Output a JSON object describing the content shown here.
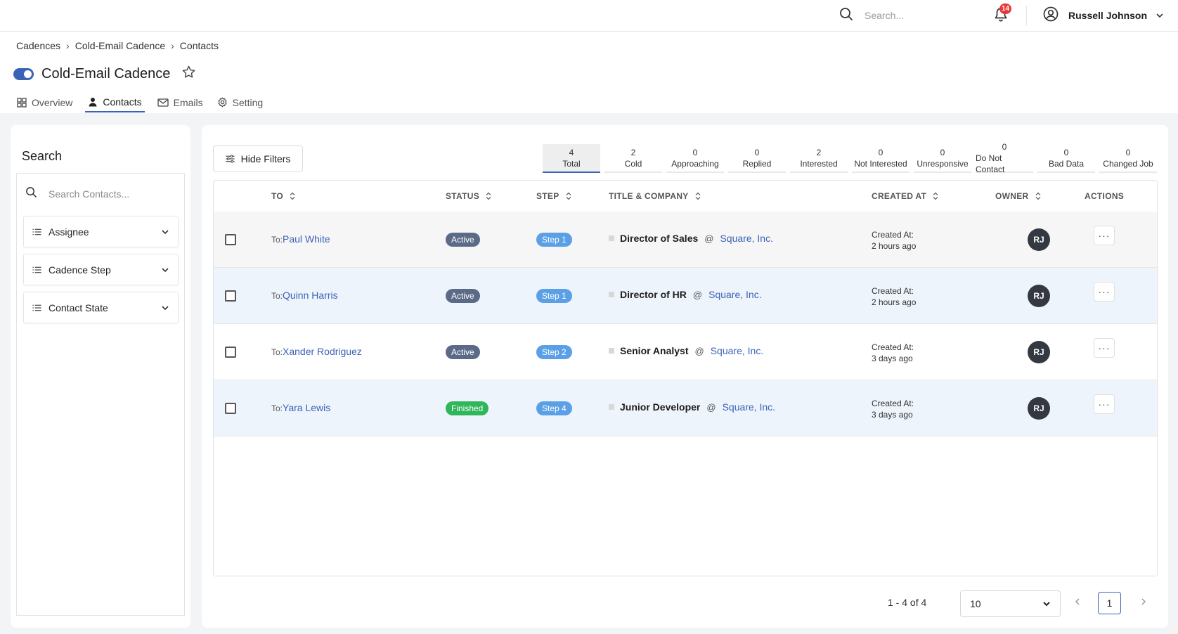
{
  "topbar": {
    "search_placeholder": "Search...",
    "notification_count": "14",
    "user_name": "Russell Johnson"
  },
  "breadcrumb": [
    "Cadences",
    "Cold-Email Cadence",
    "Contacts"
  ],
  "page": {
    "title": "Cold-Email Cadence",
    "tabs": [
      {
        "label": "Overview",
        "icon": "grid-icon"
      },
      {
        "label": "Contacts",
        "icon": "person-icon"
      },
      {
        "label": "Emails",
        "icon": "mail-icon"
      },
      {
        "label": "Setting",
        "icon": "gear-icon"
      }
    ],
    "active_tab": "Contacts"
  },
  "filters": {
    "heading": "Search",
    "search_placeholder": "Search Contacts...",
    "groups": [
      "Assignee",
      "Cadence Step",
      "Contact State"
    ]
  },
  "toolbar": {
    "hide_filters_label": "Hide Filters"
  },
  "stats": [
    {
      "count": "4",
      "label": "Total"
    },
    {
      "count": "2",
      "label": "Cold"
    },
    {
      "count": "0",
      "label": "Approaching"
    },
    {
      "count": "0",
      "label": "Replied"
    },
    {
      "count": "2",
      "label": "Interested"
    },
    {
      "count": "0",
      "label": "Not Interested"
    },
    {
      "count": "0",
      "label": "Unresponsive"
    },
    {
      "count": "0",
      "label": "Do Not Contact"
    },
    {
      "count": "0",
      "label": "Bad Data"
    },
    {
      "count": "0",
      "label": "Changed Job"
    }
  ],
  "table": {
    "headers": {
      "to": "TO",
      "status": "STATUS",
      "step": "STEP",
      "title_company": "TITLE & COMPANY",
      "created_at": "CREATED AT",
      "owner": "OWNER",
      "actions": "ACTIONS"
    },
    "to_prefix": "To:",
    "at_symbol": "@",
    "created_prefix": "Created At:",
    "rows": [
      {
        "name": "Paul White",
        "status": "Active",
        "step": "Step 1",
        "title": "Director of Sales",
        "company": "Square, Inc.",
        "created": "2 hours ago",
        "owner": "RJ"
      },
      {
        "name": "Quinn Harris",
        "status": "Active",
        "step": "Step 1",
        "title": "Director of HR",
        "company": "Square, Inc.",
        "created": "2 hours ago",
        "owner": "RJ"
      },
      {
        "name": "Xander Rodriguez",
        "status": "Active",
        "step": "Step 2",
        "title": "Senior Analyst",
        "company": "Square, Inc.",
        "created": "3 days ago",
        "owner": "RJ"
      },
      {
        "name": "Yara Lewis",
        "status": "Finished",
        "step": "Step 4",
        "title": "Junior Developer",
        "company": "Square, Inc.",
        "created": "3 days ago",
        "owner": "RJ"
      }
    ]
  },
  "pagination": {
    "range": "1 - 4 of 4",
    "per_page": "10",
    "current_page": "1"
  },
  "colors": {
    "accent": "#3a63b8",
    "active_badge": "#5b6b87",
    "finished_badge": "#2fb55a",
    "step_badge": "#5ba0e6",
    "notification_badge": "#e53935"
  }
}
